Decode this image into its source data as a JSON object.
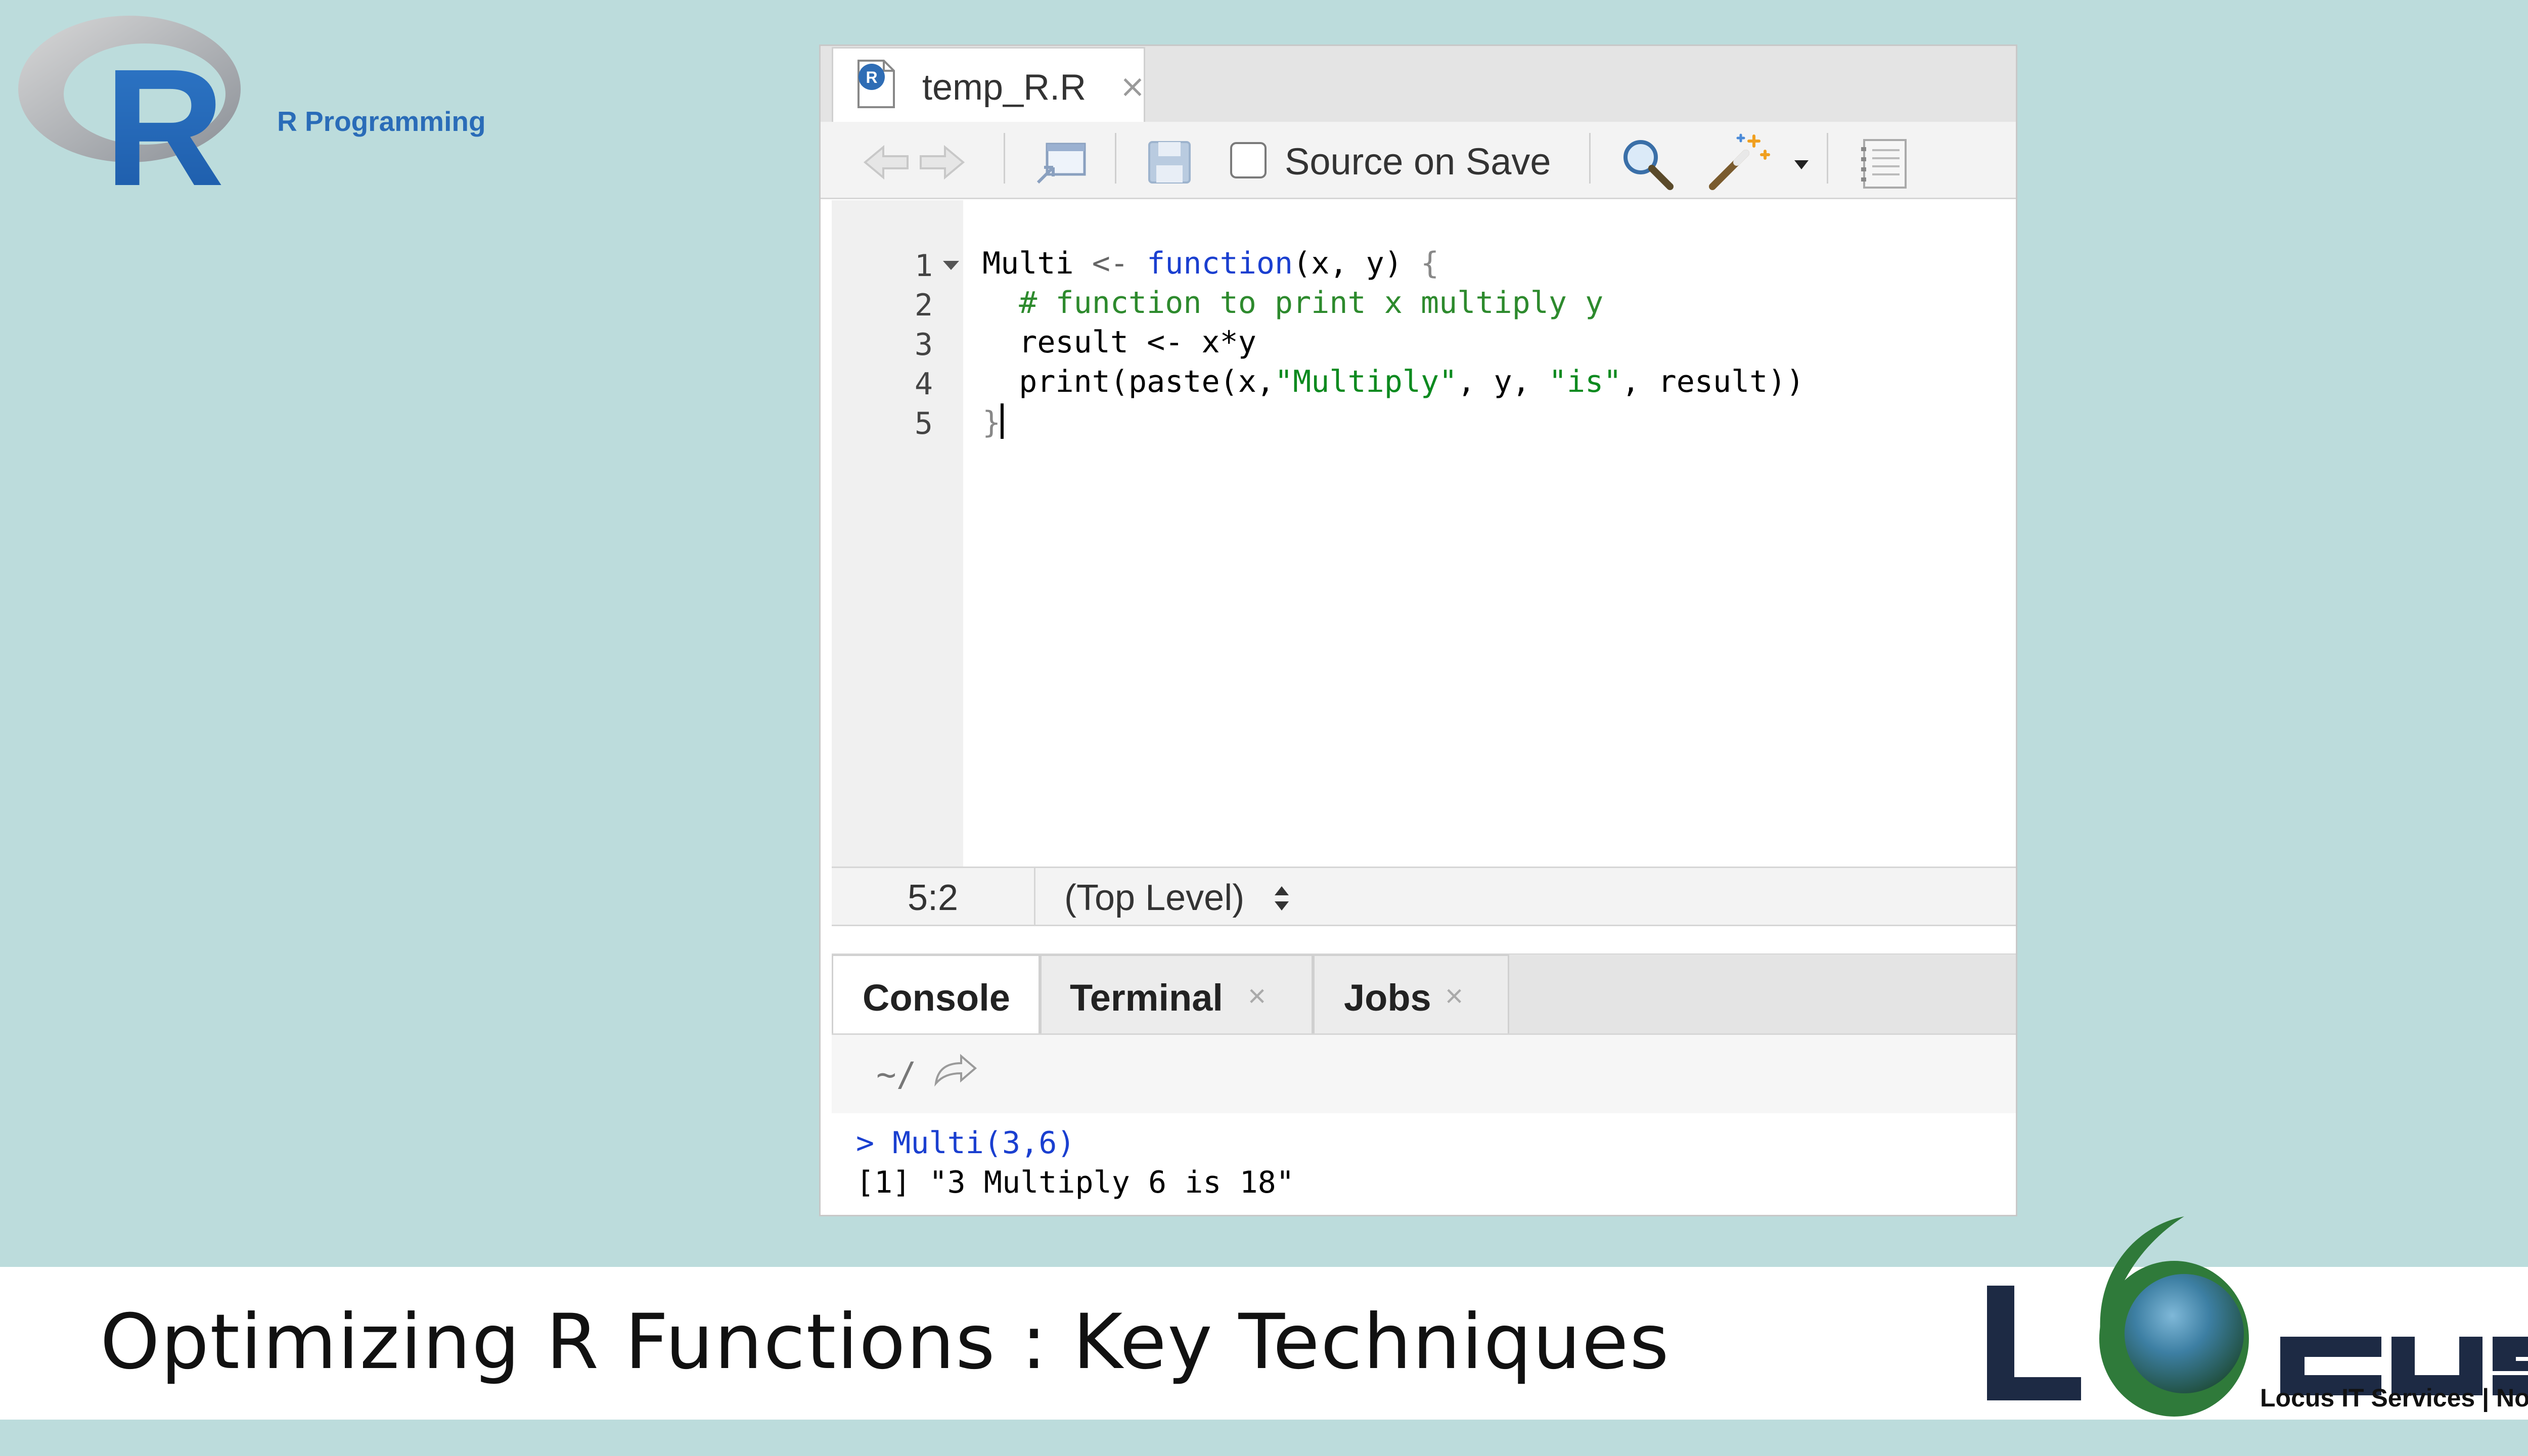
{
  "brand": {
    "r_logo_letter": "R",
    "r_title": "R Programming"
  },
  "editor": {
    "file_tab": {
      "name": "temp_R.R",
      "close": "×"
    },
    "toolbar": {
      "source_on_save_label": "Source on Save",
      "source_on_save_checked": false,
      "icons": [
        "back-arrow-icon",
        "forward-arrow-icon",
        "show-in-window-icon",
        "save-icon",
        "search-icon",
        "code-tools-wand-icon",
        "compile-notebook-icon"
      ]
    },
    "line_numbers": [
      "1",
      "2",
      "3",
      "4",
      "5"
    ],
    "code": {
      "l1_name": "Multi",
      "l1_assign": "<-",
      "l1_keyword": "function",
      "l1_args": "(x, y)",
      "l1_brace": "{",
      "l2_comment": "# function to print x multiply y",
      "l3_text": "result <- x*y",
      "l4_a": "print(paste(x,",
      "l4_s1": "\"Multiply\"",
      "l4_b": ", y, ",
      "l4_s2": "\"is\"",
      "l4_c": ", result))",
      "l5_brace": "}"
    },
    "status": {
      "cursor_pos": "5:2",
      "scope": "(Top Level)"
    }
  },
  "console": {
    "tabs": [
      {
        "label": "Console",
        "closable": false
      },
      {
        "label": "Terminal",
        "closable": true
      },
      {
        "label": "Jobs",
        "closable": true
      }
    ],
    "close_glyph": "×",
    "working_dir": "~/",
    "lines": {
      "cmd": "> Multi(3,6)",
      "output": "[1] \"3 Multiply 6 is 18\"",
      "prompt1": ">",
      "prompt2": ">"
    }
  },
  "banner": {
    "headline": "Optimizing R Functions : Key Techniques",
    "logo_tagline": "Locus IT Services | Nordic"
  },
  "colors": {
    "background": "#bcdcdc",
    "keyword": "#1a3fd0",
    "comment": "#2d8a2d",
    "string": "#0c8a1f",
    "console_input": "#1a3fd0",
    "console_error": "#d03030",
    "r_blue": "#2a6cb8",
    "locus_navy": "#1d2a44",
    "locus_green": "#2f7a3a"
  }
}
